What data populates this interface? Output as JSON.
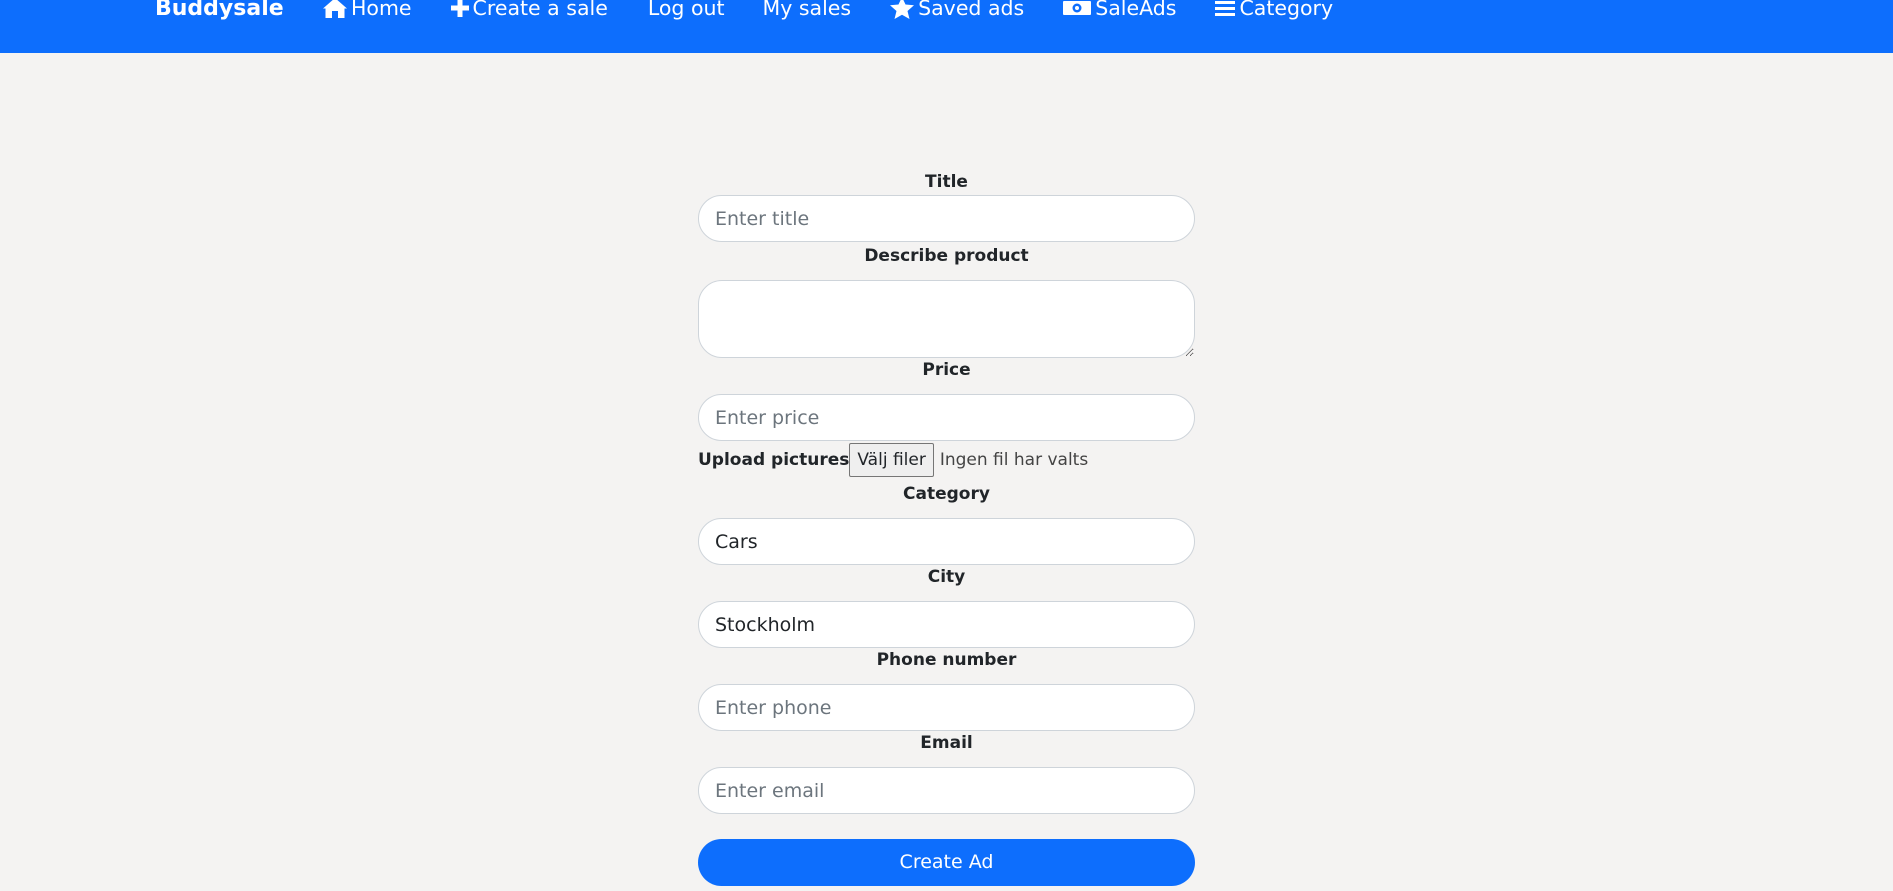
{
  "colors": {
    "brand": "#0d6efd",
    "background": "#f4f3f2"
  },
  "navbar": {
    "brand": "Buddysale",
    "items": [
      {
        "label": "Home",
        "icon": "home-icon"
      },
      {
        "label": "Create a sale",
        "icon": "plus-icon"
      },
      {
        "label": "Log out",
        "icon": ""
      },
      {
        "label": "My sales",
        "icon": ""
      },
      {
        "label": "Saved ads",
        "icon": "star-icon"
      },
      {
        "label": "SaleAds",
        "icon": "money-icon"
      },
      {
        "label": "Category",
        "icon": "menu-icon"
      }
    ]
  },
  "form": {
    "title_label": "Title",
    "title_placeholder": "Enter title",
    "description_label": "Describe product",
    "price_label": "Price",
    "price_placeholder": "Enter price",
    "upload_label": "Upload pictures",
    "upload_button": "Välj filer",
    "upload_status": "Ingen fil har valts",
    "category_label": "Category",
    "category_value": "Cars",
    "city_label": "City",
    "city_value": "Stockholm",
    "phone_label": "Phone number",
    "phone_placeholder": "Enter phone",
    "email_label": "Email",
    "email_placeholder": "Enter email",
    "submit_label": "Create Ad"
  }
}
